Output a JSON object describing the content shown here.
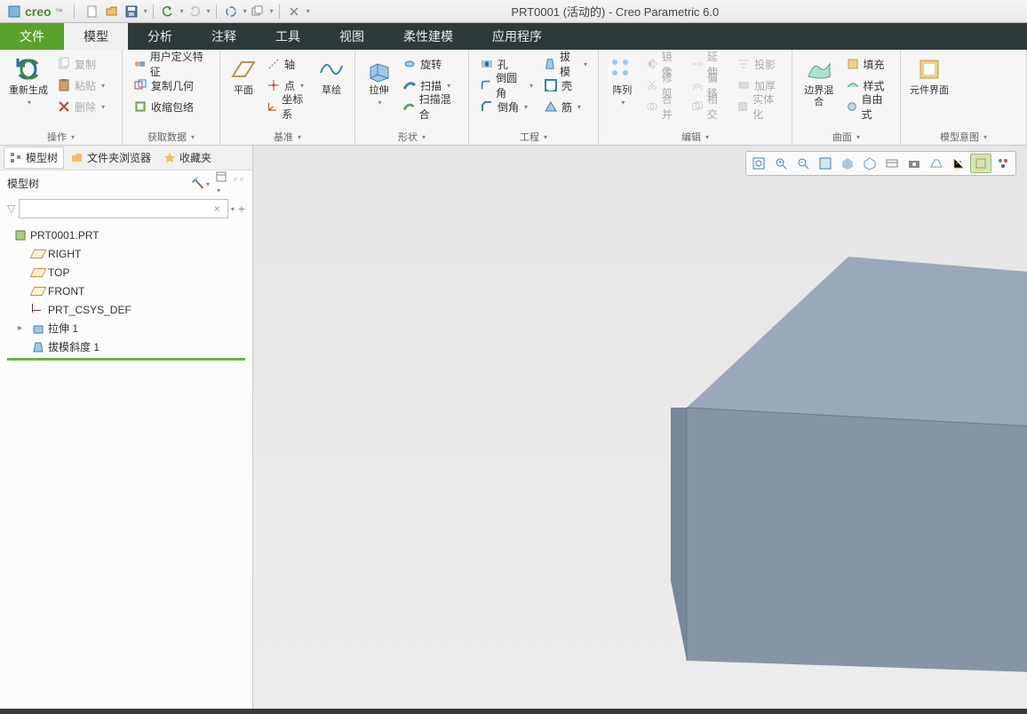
{
  "app": {
    "logo_text": "creo",
    "title": "PRT0001 (活动的) - Creo Parametric 6.0"
  },
  "menutabs": {
    "file": "文件",
    "items": [
      "模型",
      "分析",
      "注释",
      "工具",
      "视图",
      "柔性建模",
      "应用程序"
    ],
    "active_index": 0
  },
  "ribbon": {
    "groups": {
      "operate": {
        "label": "操作",
        "regen": "重新生成",
        "copy": "复制",
        "paste": "粘贴",
        "delete": "删除"
      },
      "getdata": {
        "label": "获取数据",
        "udf": "用户定义特征",
        "copygeom": "复制几何",
        "shrinkwrap": "收缩包络"
      },
      "datum": {
        "label": "基准",
        "plane": "平面",
        "sketch": "草绘",
        "axis": "轴",
        "point": "点",
        "csys": "坐标系"
      },
      "shape": {
        "label": "形状",
        "extrude": "拉伸",
        "revolve": "旋转",
        "sweep": "扫描",
        "sweepblend": "扫描混合"
      },
      "eng": {
        "label": "工程",
        "hole": "孔",
        "round": "倒圆角",
        "chamfer": "倒角",
        "draft": "拔模",
        "shell": "壳",
        "rib": "筋"
      },
      "edit": {
        "label": "编辑",
        "pattern": "阵列",
        "mirror": "镜像",
        "trim": "修剪",
        "merge": "合并",
        "extend": "延伸",
        "offset": "偏移",
        "intersect": "相交",
        "project": "投影",
        "thicken": "加厚",
        "solidify": "实体化"
      },
      "surface": {
        "label": "曲面",
        "boundary": "边界混合",
        "fill": "填充",
        "style": "样式",
        "freestyle": "自由式"
      },
      "intent": {
        "label": "模型意图",
        "component": "元件界面"
      }
    }
  },
  "sidepanel": {
    "tabs": {
      "modeltree": "模型树",
      "folder": "文件夹浏览器",
      "favorites": "收藏夹"
    },
    "header": "模型树",
    "tree": {
      "root": "PRT0001.PRT",
      "items": [
        {
          "label": "RIGHT",
          "type": "plane"
        },
        {
          "label": "TOP",
          "type": "plane"
        },
        {
          "label": "FRONT",
          "type": "plane"
        },
        {
          "label": "PRT_CSYS_DEF",
          "type": "csys"
        },
        {
          "label": "拉伸 1",
          "type": "feature",
          "arrow": true
        },
        {
          "label": "拔模斜度 1",
          "type": "feature"
        }
      ]
    }
  },
  "filter_value": ""
}
